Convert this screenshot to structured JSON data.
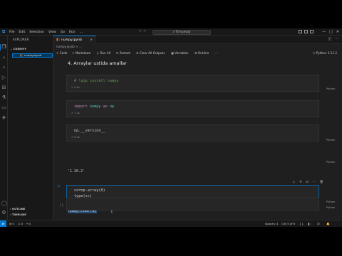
{
  "titlebar": {
    "menu": [
      "File",
      "Edit",
      "Selection",
      "View",
      "Go",
      "Run",
      "..."
    ],
    "search": "Timumpy",
    "window_controls": [
      "—",
      "□",
      "✕"
    ]
  },
  "sidebar": {
    "header": "EXPLORER",
    "folder": "CURRIFY",
    "file": "numpy.ipynb",
    "outline": "OUTLINE",
    "timeline": "TIMELINE"
  },
  "tab": {
    "label": "numpy.ipynb",
    "close": "×"
  },
  "breadcrumb": "numpy.ipynb > ...",
  "toolbar": {
    "code": "+ Code",
    "markdown": "+ Markdown",
    "run_all": "Run All",
    "restart": "Restart",
    "clear_outputs": "Clear All Outputs",
    "variables": "Variables",
    "outline": "Outline",
    "more": "···",
    "kernel": "Python 3.11.2"
  },
  "notebook": {
    "heading": "4. Arraylar ustida amallar",
    "cells": [
      {
        "code": "# !pip install numpy",
        "status": "0.0s",
        "lang": "Python"
      },
      {
        "code": "import numpy as np",
        "status": "1.3s",
        "lang": "Python"
      },
      {
        "code": "np.__version__",
        "status": "0.0s",
        "lang": "Python",
        "output": "'1.26.2'"
      },
      {
        "code": "sc=np.array(0)\ntype(sc)",
        "status": "0.0s",
        "lang": "Python",
        "output": "numpy.ndarray"
      },
      {
        "code": "",
        "status": "",
        "lang": "Python"
      }
    ]
  },
  "statusbar": {
    "errors": "⊗ 0",
    "warnings": "⚠ 0",
    "ports": "⑂ 0",
    "spaces": "Spaces: 4",
    "cell": "Cell 5 of 6",
    "notif": "🔔"
  },
  "colors": {
    "accent": "#0078d4",
    "success": "#89d185",
    "editor_bg": "#1f1f1f",
    "selection": "#264f78"
  }
}
